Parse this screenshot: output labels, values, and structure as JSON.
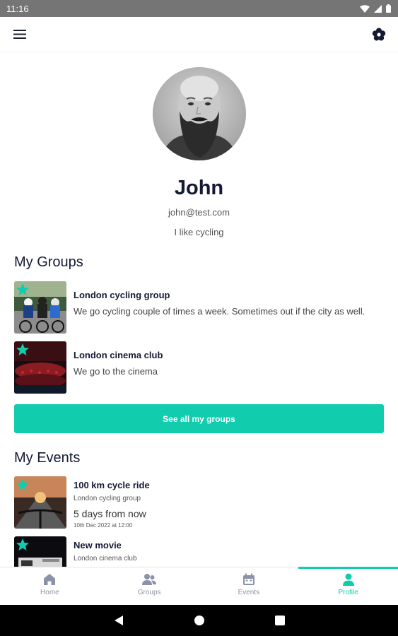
{
  "status_bar": {
    "time": "11:16"
  },
  "app_bar": {
    "menu_icon": "hamburger-menu-icon",
    "settings_icon": "settings-flower-icon"
  },
  "profile": {
    "name": "John",
    "email": "john@test.com",
    "bio": "I like cycling"
  },
  "groups": {
    "title": "My Groups",
    "items": [
      {
        "name": "London cycling group",
        "description": "We go cycling couple of times a week. Sometimes out if the city as well."
      },
      {
        "name": "London cinema club",
        "description": "We go to the cinema"
      }
    ],
    "see_all_label": "See all my groups"
  },
  "events": {
    "title": "My Events",
    "items": [
      {
        "name": "100 km cycle ride",
        "group": "London cycling group",
        "relative": "5 days from now",
        "date": "10th Dec 2022 at 12:00"
      },
      {
        "name": "New movie",
        "group": "London cinema club"
      }
    ]
  },
  "bottom_nav": {
    "items": [
      {
        "label": "Home",
        "icon": "home-icon"
      },
      {
        "label": "Groups",
        "icon": "groups-icon"
      },
      {
        "label": "Events",
        "icon": "calendar-icon"
      },
      {
        "label": "Profile",
        "icon": "person-icon"
      }
    ],
    "active": "Profile"
  },
  "colors": {
    "accent": "#11ccad",
    "text_dark": "#141a33",
    "status_bar": "#757575"
  }
}
